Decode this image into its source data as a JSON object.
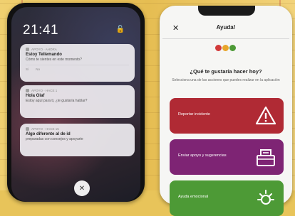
{
  "left_phone": {
    "time": "21:41",
    "lock_icon": "unlocked-lock-icon",
    "notifications": [
      {
        "app": "APOYO · AHORA",
        "title": "Estoy Tellemando",
        "body": "Cómo te sientes en este momento?",
        "actions": [
          "Sí",
          "No"
        ]
      },
      {
        "app": "APOYO · HACE 1",
        "title": "Hola Olaf",
        "body": "Estoy aquí para ti, ¿te gustaría hablar?"
      },
      {
        "app": "APOYO · HACE 15",
        "title": "Algo diferente al de id",
        "body": "preparadas con consejos y apoyarte"
      }
    ],
    "home_button_icon": "close-icon"
  },
  "right_phone": {
    "close_icon": "close-icon",
    "title": "Ayuda!",
    "logo_colors": [
      "#d23a3a",
      "#e8a52a",
      "#4d9a36"
    ],
    "question": "¿Qué te gustaría hacer hoy?",
    "subtitle": "Selecciona una de las acciones que puedes realizar en la aplicación",
    "cards": [
      {
        "label": "Reportar incidente",
        "icon": "warning-triangle-icon",
        "color": "#b02a34"
      },
      {
        "label": "Enviar apoyo y sugerencias",
        "icon": "envelope-box-icon",
        "color": "#7e2474"
      },
      {
        "label": "Ayuda emocional",
        "icon": "sun-icon",
        "color": "#4d9a36"
      }
    ]
  }
}
